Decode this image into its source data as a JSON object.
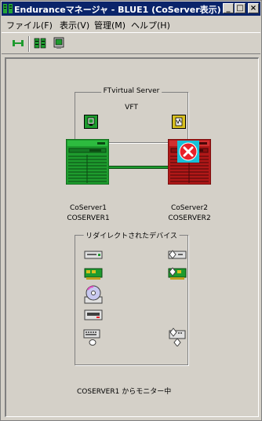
{
  "window": {
    "title": "Enduranceマネージャ - BLUE1 (CoServer表示)",
    "min_btn": "_",
    "max_btn": "□",
    "close_btn": "×"
  },
  "menu": [
    "ファイル(F)",
    "表示(V)",
    "管理(M)",
    "ヘルプ(H)"
  ],
  "ftvirtual": {
    "group_title": "FTvirtual Server",
    "name": "VFT"
  },
  "coserver1": {
    "name": "CoServer1",
    "host": "COSERVER1",
    "status": "ok",
    "color": "#1e9b2e"
  },
  "coserver2": {
    "name": "CoServer2",
    "host": "COSERVER2",
    "status": "failed",
    "color": "#b01818"
  },
  "redirected": {
    "group_title": "リダイレクトされたデバイス"
  },
  "status_text": "COSERVER1 からモニター中",
  "colors": {
    "titlebar": "#0a246a",
    "face": "#d4d0c8",
    "link": "#1e9b2e",
    "error": "#e8202a"
  }
}
